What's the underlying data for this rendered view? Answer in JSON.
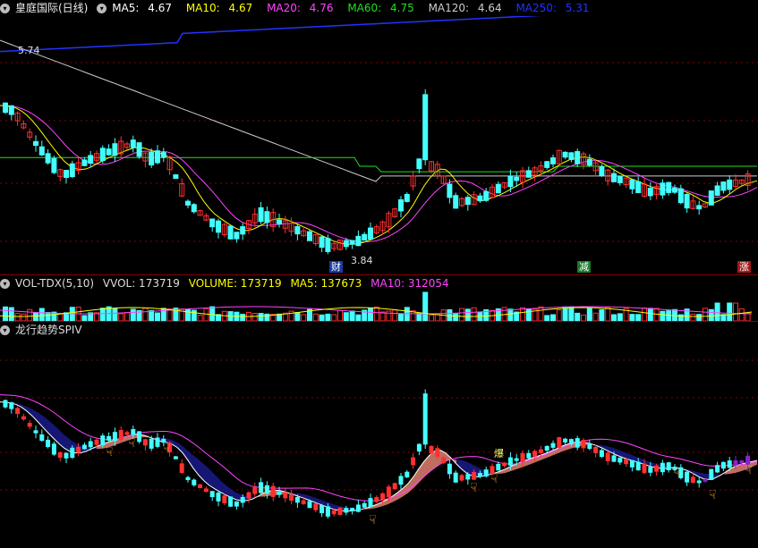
{
  "main": {
    "stock": "皇庭国际(日线)",
    "ma": [
      {
        "label": "MA5: ",
        "value": "4.67",
        "color": "#ffffff"
      },
      {
        "label": "MA10: ",
        "value": "4.67",
        "color": "#ffff00"
      },
      {
        "label": "MA20: ",
        "value": "4.76",
        "color": "#ff44ff"
      },
      {
        "label": "MA60: ",
        "value": "4.75",
        "color": "#22dd22"
      },
      {
        "label": "MA120: ",
        "value": "4.64",
        "color": "#cccccc"
      },
      {
        "label": "MA250: ",
        "value": "5.31",
        "color": "#2233ff"
      }
    ],
    "high_label": "5.74",
    "low_label": "3.84",
    "tag_cai": "财",
    "tag_jian": "减",
    "tag_zhang": "涨"
  },
  "volume": {
    "title": "VOL-TDX(5,10)",
    "vvol": "VVOL: 173719",
    "volume": "VOLUME: 173719",
    "ma5": "MA5: 137673",
    "ma10": "MA10: 312054"
  },
  "indicator": {
    "title": "龙行趋势SPIV",
    "bao": "爆"
  },
  "colors": {
    "up": "#ff3030",
    "down": "#44ffff",
    "grid": "#8a0000",
    "ma250": "#2233ff",
    "ma60": "#22dd22",
    "ma20": "#ff44ff",
    "ma10": "#ffff00",
    "ma120": "#cccccc"
  }
}
